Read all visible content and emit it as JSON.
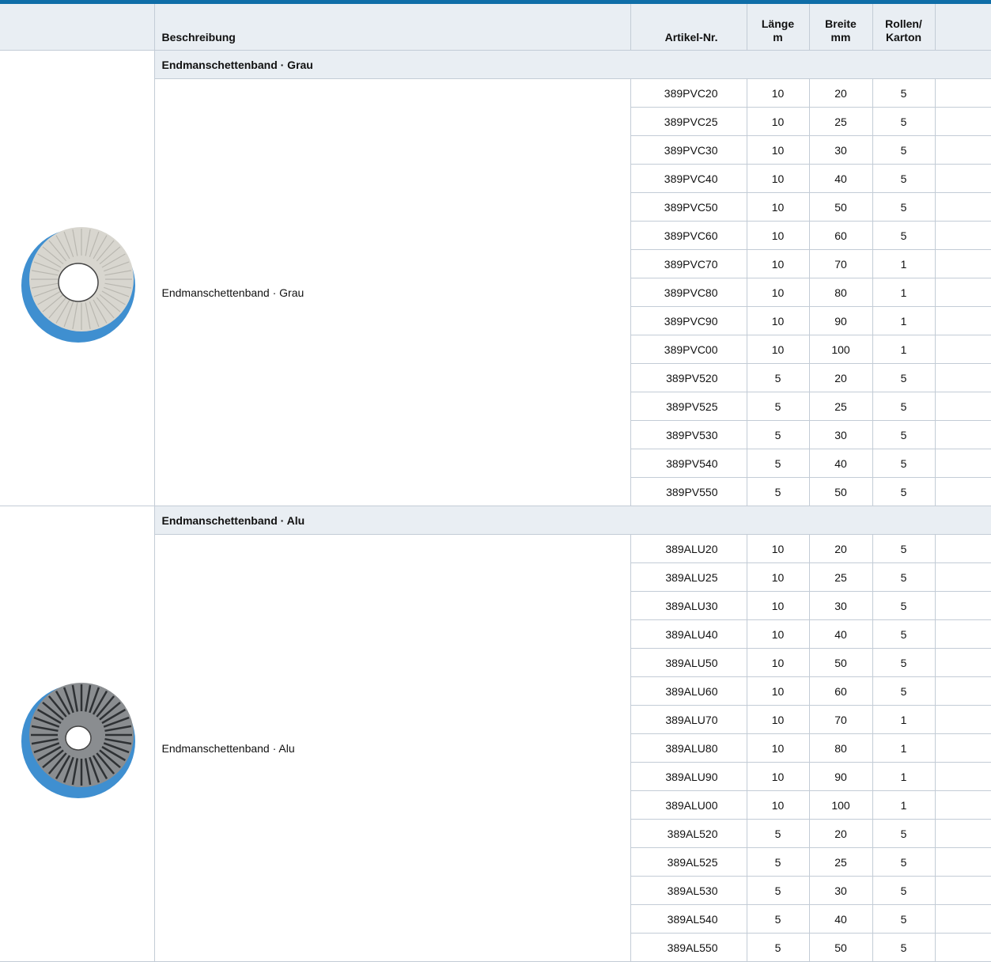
{
  "headers": {
    "description": "Beschreibung",
    "article": "Artikel-Nr.",
    "length": [
      "Länge",
      "m"
    ],
    "width": [
      "Breite",
      "mm"
    ],
    "rolls": [
      "Rollen/",
      "Karton"
    ]
  },
  "groups": [
    {
      "title": "Endmanschettenband · Grau",
      "description": "Endmanschettenband · Grau",
      "image_icon": "grey-cuff-tape-roll-icon",
      "colors": {
        "band": "#3f8fd0",
        "face": "#d8d6cf",
        "hole": "#ffffff"
      },
      "rows": [
        {
          "art": "389PVC20",
          "len": "10",
          "width": "20",
          "rolls": "5"
        },
        {
          "art": "389PVC25",
          "len": "10",
          "width": "25",
          "rolls": "5"
        },
        {
          "art": "389PVC30",
          "len": "10",
          "width": "30",
          "rolls": "5"
        },
        {
          "art": "389PVC40",
          "len": "10",
          "width": "40",
          "rolls": "5"
        },
        {
          "art": "389PVC50",
          "len": "10",
          "width": "50",
          "rolls": "5"
        },
        {
          "art": "389PVC60",
          "len": "10",
          "width": "60",
          "rolls": "5"
        },
        {
          "art": "389PVC70",
          "len": "10",
          "width": "70",
          "rolls": "1"
        },
        {
          "art": "389PVC80",
          "len": "10",
          "width": "80",
          "rolls": "1"
        },
        {
          "art": "389PVC90",
          "len": "10",
          "width": "90",
          "rolls": "1"
        },
        {
          "art": "389PVC00",
          "len": "10",
          "width": "100",
          "rolls": "1"
        },
        {
          "art": "389PV520",
          "len": "5",
          "width": "20",
          "rolls": "5"
        },
        {
          "art": "389PV525",
          "len": "5",
          "width": "25",
          "rolls": "5"
        },
        {
          "art": "389PV530",
          "len": "5",
          "width": "30",
          "rolls": "5"
        },
        {
          "art": "389PV540",
          "len": "5",
          "width": "40",
          "rolls": "5"
        },
        {
          "art": "389PV550",
          "len": "5",
          "width": "50",
          "rolls": "5"
        }
      ]
    },
    {
      "title": "Endmanschettenband · Alu",
      "description": "Endmanschettenband · Alu",
      "image_icon": "alu-cuff-tape-roll-icon",
      "colors": {
        "band": "#3f8fd0",
        "face": "#8a8d90",
        "hole": "#ffffff"
      },
      "rows": [
        {
          "art": "389ALU20",
          "len": "10",
          "width": "20",
          "rolls": "5"
        },
        {
          "art": "389ALU25",
          "len": "10",
          "width": "25",
          "rolls": "5"
        },
        {
          "art": "389ALU30",
          "len": "10",
          "width": "30",
          "rolls": "5"
        },
        {
          "art": "389ALU40",
          "len": "10",
          "width": "40",
          "rolls": "5"
        },
        {
          "art": "389ALU50",
          "len": "10",
          "width": "50",
          "rolls": "5"
        },
        {
          "art": "389ALU60",
          "len": "10",
          "width": "60",
          "rolls": "5"
        },
        {
          "art": "389ALU70",
          "len": "10",
          "width": "70",
          "rolls": "1"
        },
        {
          "art": "389ALU80",
          "len": "10",
          "width": "80",
          "rolls": "1"
        },
        {
          "art": "389ALU90",
          "len": "10",
          "width": "90",
          "rolls": "1"
        },
        {
          "art": "389ALU00",
          "len": "10",
          "width": "100",
          "rolls": "1"
        },
        {
          "art": "389AL520",
          "len": "5",
          "width": "20",
          "rolls": "5"
        },
        {
          "art": "389AL525",
          "len": "5",
          "width": "25",
          "rolls": "5"
        },
        {
          "art": "389AL530",
          "len": "5",
          "width": "30",
          "rolls": "5"
        },
        {
          "art": "389AL540",
          "len": "5",
          "width": "40",
          "rolls": "5"
        },
        {
          "art": "389AL550",
          "len": "5",
          "width": "50",
          "rolls": "5"
        }
      ]
    }
  ]
}
